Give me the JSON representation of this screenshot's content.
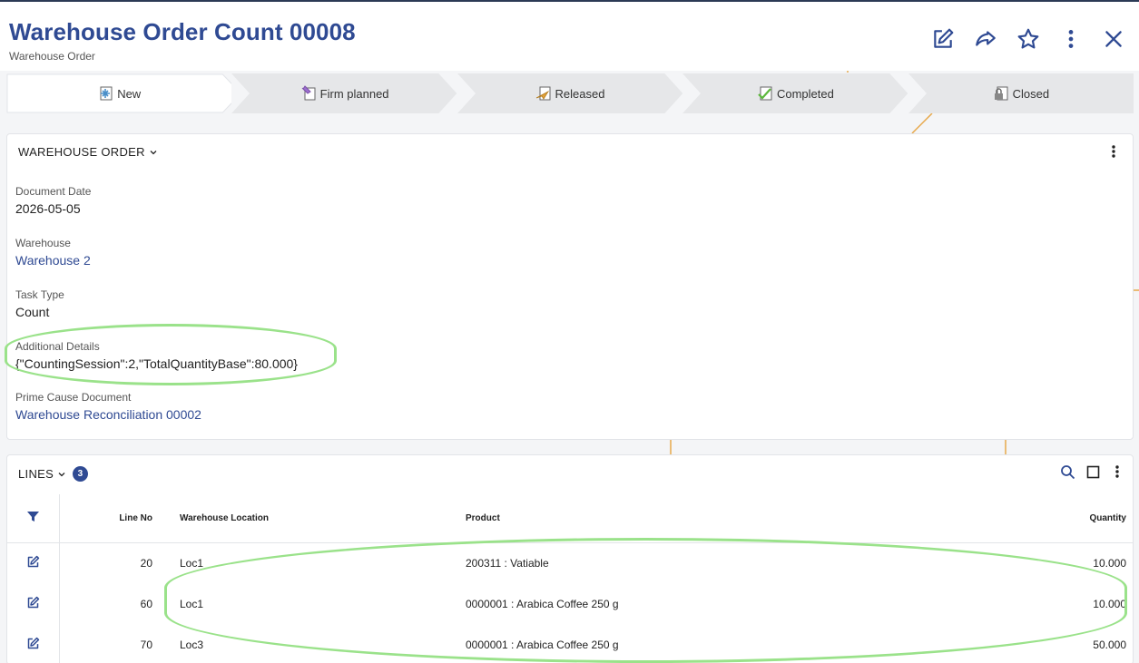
{
  "header": {
    "title": "Warehouse Order Count 00008",
    "subtitle": "Warehouse Order",
    "actions": [
      "edit-icon",
      "share-icon",
      "star-icon",
      "more-vertical-icon",
      "close-icon"
    ]
  },
  "stages": [
    {
      "label": "New",
      "icon": "new-doc-icon",
      "active": true
    },
    {
      "label": "Firm planned",
      "icon": "pin-doc-icon",
      "active": false
    },
    {
      "label": "Released",
      "icon": "plane-doc-icon",
      "active": false
    },
    {
      "label": "Completed",
      "icon": "check-doc-icon",
      "active": false
    },
    {
      "label": "Closed",
      "icon": "lock-doc-icon",
      "active": false
    }
  ],
  "warehouse_order": {
    "section_title": "WAREHOUSE ORDER",
    "fields": {
      "document_date": {
        "label": "Document Date",
        "value": "2026-05-05"
      },
      "warehouse": {
        "label": "Warehouse",
        "value": "Warehouse 2"
      },
      "task_type": {
        "label": "Task Type",
        "value": "Count"
      },
      "additional_details": {
        "label": "Additional Details",
        "value": "{\"CountingSession\":2,\"TotalQuantityBase\":80.000}"
      },
      "prime_cause": {
        "label": "Prime Cause Document",
        "value": "Warehouse Reconciliation 00002"
      }
    }
  },
  "lines": {
    "section_title": "LINES",
    "count": "3",
    "columns": {
      "line_no": "Line No",
      "location": "Warehouse Location",
      "product": "Product",
      "quantity": "Quantity"
    },
    "rows": [
      {
        "line_no": "20",
        "location": "Loc1",
        "product": "200311 : Vatiable",
        "quantity": "10.000"
      },
      {
        "line_no": "60",
        "location": "Loc1",
        "product": "0000001 : Arabica Coffee 250 g",
        "quantity": "10.000"
      },
      {
        "line_no": "70",
        "location": "Loc3",
        "product": "0000001 : Arabica Coffee 250 g",
        "quantity": "50.000"
      }
    ]
  },
  "colors": {
    "brand": "#2f4a93",
    "highlight": "#9ae28a",
    "accent_line": "#e7a84a"
  }
}
